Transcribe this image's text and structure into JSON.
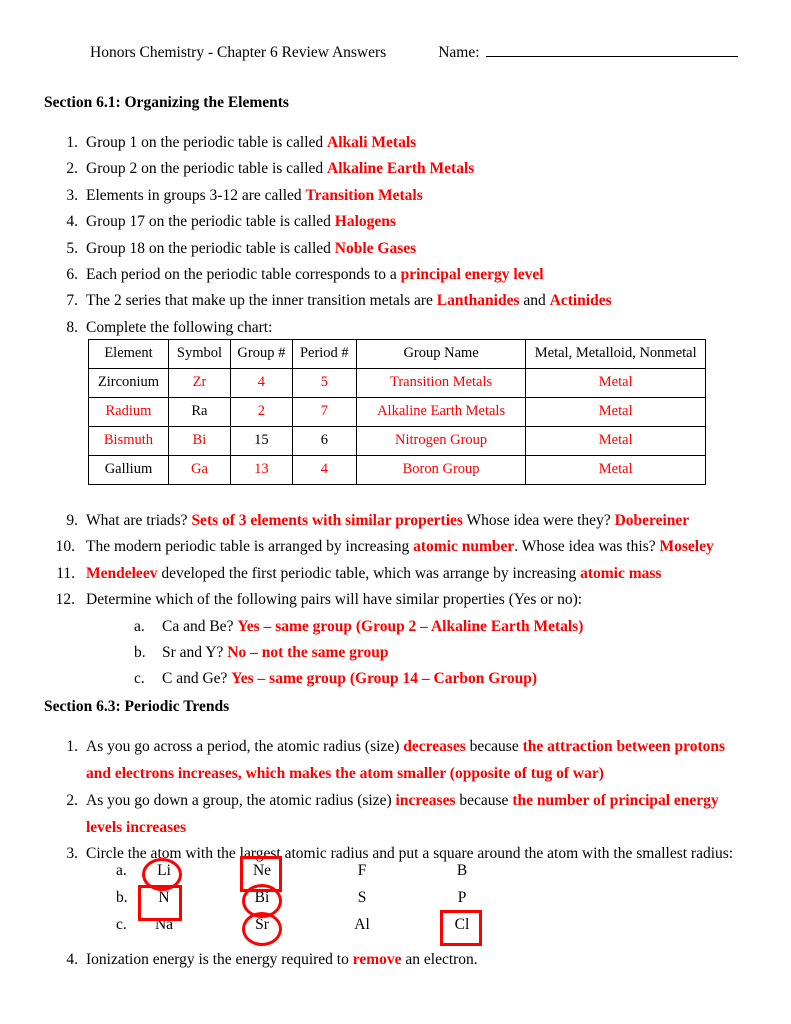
{
  "header": {
    "title": "Honors Chemistry - Chapter 6 Review Answers",
    "name_label": "Name:"
  },
  "section_61": {
    "heading": "Section 6.1: Organizing the Elements",
    "items": [
      {
        "num": "1.",
        "pre": "Group 1 on the periodic table is called ",
        "ans": "Alkali Metals",
        "post": ""
      },
      {
        "num": "2.",
        "pre": "Group 2 on the periodic table is called ",
        "ans": "Alkaline Earth Metals",
        "post": ""
      },
      {
        "num": "3.",
        "pre": "Elements in groups 3-12 are called ",
        "ans": "Transition Metals",
        "post": ""
      },
      {
        "num": "4.",
        "pre": "Group 17 on the periodic table is called ",
        "ans": "Halogens",
        "post": ""
      },
      {
        "num": "5.",
        "pre": "Group 18 on the periodic table is called ",
        "ans": "Noble Gases",
        "post": ""
      },
      {
        "num": "6.",
        "pre": "Each period on the periodic table corresponds to a ",
        "ans": "principal energy level",
        "post": ""
      },
      {
        "num": "7.",
        "pre": " The 2 series that make up the inner transition metals are ",
        "ans": "Lanthanides",
        "post": " and ",
        "ans2": "Actinides"
      },
      {
        "num": "8.",
        "pre": "Complete the following chart:",
        "ans": "",
        "post": ""
      }
    ]
  },
  "chart": {
    "headers": [
      "Element",
      "Symbol",
      "Group #",
      "Period #",
      "Group Name",
      "Metal, Metalloid, Nonmetal"
    ],
    "rows": [
      {
        "cells": [
          {
            "text": "Zirconium",
            "red": false
          },
          {
            "text": "Zr",
            "red": true
          },
          {
            "text": "4",
            "red": true
          },
          {
            "text": "5",
            "red": true
          },
          {
            "text": "Transition Metals",
            "red": true
          },
          {
            "text": "Metal",
            "red": true
          }
        ]
      },
      {
        "cells": [
          {
            "text": "Radium",
            "red": true
          },
          {
            "text": "Ra",
            "red": false
          },
          {
            "text": "2",
            "red": true
          },
          {
            "text": "7",
            "red": true
          },
          {
            "text": "Alkaline Earth Metals",
            "red": true
          },
          {
            "text": "Metal",
            "red": true
          }
        ]
      },
      {
        "cells": [
          {
            "text": "Bismuth",
            "red": true
          },
          {
            "text": "Bi",
            "red": true
          },
          {
            "text": "15",
            "red": false
          },
          {
            "text": "6",
            "red": false
          },
          {
            "text": "Nitrogen Group",
            "red": true
          },
          {
            "text": "Metal",
            "red": true
          }
        ]
      },
      {
        "cells": [
          {
            "text": "Gallium",
            "red": false
          },
          {
            "text": "Ga",
            "red": true
          },
          {
            "text": "13",
            "red": true
          },
          {
            "text": "4",
            "red": true
          },
          {
            "text": "Boron Group",
            "red": true
          },
          {
            "text": "Metal",
            "red": true
          }
        ]
      }
    ]
  },
  "items_9_12": {
    "item9": {
      "num": "9.",
      "p1": " What are triads? ",
      "a1": "Sets of 3 elements with similar properties",
      "p2": " Whose idea were they? ",
      "a2": "Dobereiner"
    },
    "item10": {
      "num": "10.",
      "p1": "The modern periodic table is arranged by increasing ",
      "a1": "atomic number",
      "p2": ". Whose idea was this? ",
      "a2": "Moseley"
    },
    "item11": {
      "num": "11.",
      "a1": "Mendeleev",
      "p1": " developed the first periodic table, which was arrange by increasing ",
      "a2": "atomic mass"
    },
    "item12": {
      "num": "12.",
      "p1": "Determine which of the following pairs will have similar properties (Yes or no):",
      "subs": [
        {
          "alpha": "a.",
          "q": "Ca and Be? ",
          "ans": "Yes – same group (Group 2 – Alkaline Earth Metals)"
        },
        {
          "alpha": "b.",
          "q": "Sr and Y? ",
          "ans": "No – not the same group"
        },
        {
          "alpha": "c.",
          "q": "C and Ge? ",
          "ans": "Yes – same group (Group 14 – Carbon Group)"
        }
      ]
    }
  },
  "section_63": {
    "heading": "Section 6.3: Periodic Trends",
    "item1": {
      "num": "1.",
      "p1": "As you go across a period, the atomic radius (size) ",
      "a1": "decreases",
      "p2": " because ",
      "a2": "the attraction between protons and electrons increases, which makes the atom smaller (opposite of tug of war)"
    },
    "item2": {
      "num": "2.",
      "p1": "As you go down a group, the atomic radius (size) ",
      "a1": "increases",
      "p2": " because ",
      "a2": "the number of principal energy levels increases"
    },
    "item3": {
      "num": "3.",
      "p1": "Circle the atom with the largest atomic radius and put a square around the atom with the smallest radius:"
    },
    "element_rows": [
      {
        "alpha": "a.",
        "elements": [
          "Li",
          "Ne",
          "F",
          "B"
        ],
        "annotations": [
          "circle",
          "square",
          "none",
          "none"
        ]
      },
      {
        "alpha": "b.",
        "elements": [
          "N",
          "Bi",
          "S",
          "P"
        ],
        "annotations": [
          "square",
          "circle",
          "none",
          "none"
        ]
      },
      {
        "alpha": "c.",
        "elements": [
          "Na",
          "Sr",
          "Al",
          "Cl"
        ],
        "annotations": [
          "none",
          "circle",
          "none",
          "square"
        ]
      }
    ],
    "item4": {
      "num": "4.",
      "p1": "Ionization energy is the energy required to ",
      "a1": "remove",
      "p2": " an electron."
    }
  },
  "colors": {
    "answer_red": "#FF0000",
    "text_black": "#000000",
    "page_bg": "#FFFFFF"
  }
}
